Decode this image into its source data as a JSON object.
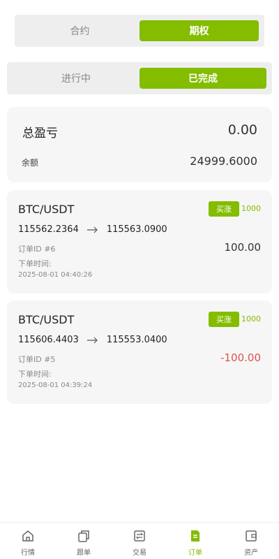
{
  "product_tabs": {
    "contract": "合约",
    "options": "期权",
    "active": "options"
  },
  "status_tabs": {
    "in_progress": "进行中",
    "completed": "已完成",
    "active": "completed"
  },
  "summary": {
    "total_pnl_label": "总盈亏",
    "total_pnl_value": "0.00",
    "balance_label": "余额",
    "balance_value": "24999.6000"
  },
  "orders": [
    {
      "pair": "BTC/USDT",
      "direction": "买涨",
      "amount": "1000",
      "open_price": "115562.2364",
      "close_price": "115563.0900",
      "order_id": "订单ID #6",
      "pnl": "100.00",
      "time_label": "下单时间:",
      "time": "2025-08-01 04:40:26"
    },
    {
      "pair": "BTC/USDT",
      "direction": "买涨",
      "amount": "1000",
      "open_price": "115606.4403",
      "close_price": "115553.0400",
      "order_id": "订单ID #5",
      "pnl": "-100.00",
      "time_label": "下单时间:",
      "time": "2025-08-01 04:39:24"
    }
  ],
  "colors": {
    "accent": "#84bc00",
    "negative": "#e05050"
  },
  "tabbar": {
    "items": [
      {
        "label": "行情",
        "icon": "home-icon"
      },
      {
        "label": "跟单",
        "icon": "copy-icon"
      },
      {
        "label": "交易",
        "icon": "exchange-icon"
      },
      {
        "label": "订单",
        "icon": "orders-icon",
        "active": true
      },
      {
        "label": "资产",
        "icon": "wallet-icon"
      }
    ]
  }
}
